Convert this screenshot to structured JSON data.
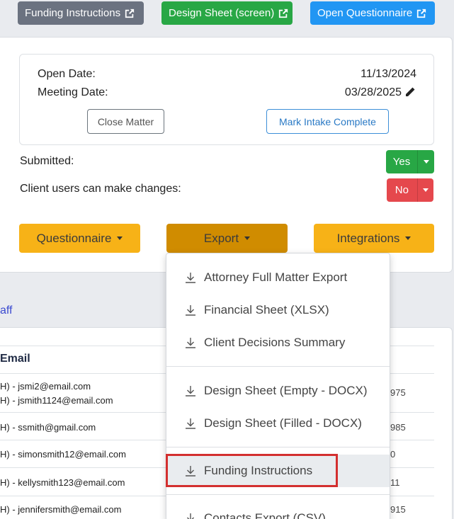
{
  "top_buttons": {
    "funding_instructions": "Funding Instructions",
    "design_sheet": "Design Sheet (screen)",
    "open_questionnaire": "Open Questionnaire"
  },
  "details": {
    "open_date_label": "Open Date:",
    "open_date_value": "11/13/2024",
    "meeting_date_label": "Meeting Date:",
    "meeting_date_value": "03/28/2025",
    "close_matter": "Close Matter",
    "mark_intake_complete": "Mark Intake Complete"
  },
  "status": {
    "submitted_label": "Submitted:",
    "submitted_value": "Yes",
    "client_changes_label": "Client users can make changes:",
    "client_changes_value": "No"
  },
  "dropdowns": {
    "questionnaire": "Questionnaire",
    "export": "Export",
    "integrations": "Integrations"
  },
  "export_menu": {
    "items": [
      "Attorney Full Matter Export",
      "Financial Sheet (XLSX)",
      "Client Decisions Summary",
      "Design Sheet (Empty - DOCX)",
      "Design Sheet (Filled - DOCX)",
      "Funding Instructions",
      "Contacts Export (CSV)"
    ]
  },
  "table": {
    "staff_link": "aff",
    "email_header": "Email",
    "rows": [
      {
        "email_1": "H) - jsmi2@email.com",
        "email_2": "H) - jsmith1124@email.com",
        "num": "975"
      },
      {
        "email_1": "H) - ssmith@gmail.com",
        "num": "985"
      },
      {
        "email_1": "H) - simonsmith12@email.com",
        "num": "0"
      },
      {
        "email_1": "H) - kellysmith123@email.com",
        "num": "11"
      },
      {
        "email_1": "H) - jennifersmith@email.com",
        "num": "915"
      }
    ]
  },
  "colors": {
    "accent_yellow": "#f7b217",
    "active_dropdown": "#d08c00",
    "green": "#28a745",
    "red": "#e5484d",
    "highlight_box": "#d32f2f"
  }
}
